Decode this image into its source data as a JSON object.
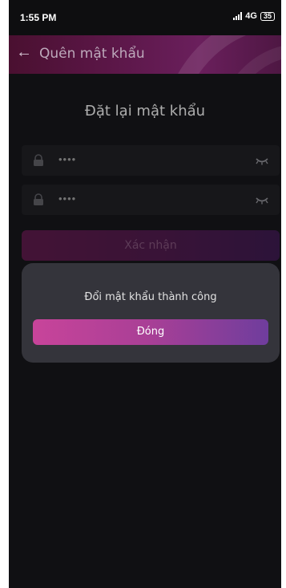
{
  "statusbar": {
    "time": "1:55 PM",
    "network": "4G",
    "battery": "35"
  },
  "appbar": {
    "back_icon": "arrow-left-icon",
    "title": "Quên mật khẩu"
  },
  "form": {
    "heading": "Đặt lại mật khẩu",
    "fields": [
      {
        "masked_value": "••••",
        "lead_icon": "lock-icon",
        "trail_icon": "eye-closed-icon"
      },
      {
        "masked_value": "••••",
        "lead_icon": "lock-icon",
        "trail_icon": "eye-closed-icon"
      }
    ],
    "submit_label": "Xác nhận"
  },
  "dialog": {
    "message": "Đổi mật khẩu thành công",
    "close_label": "Đóng"
  },
  "colors": {
    "background": "#16161a",
    "dialog": "#34343b",
    "accent_start": "#c8449a",
    "accent_end": "#6f3d9d"
  }
}
